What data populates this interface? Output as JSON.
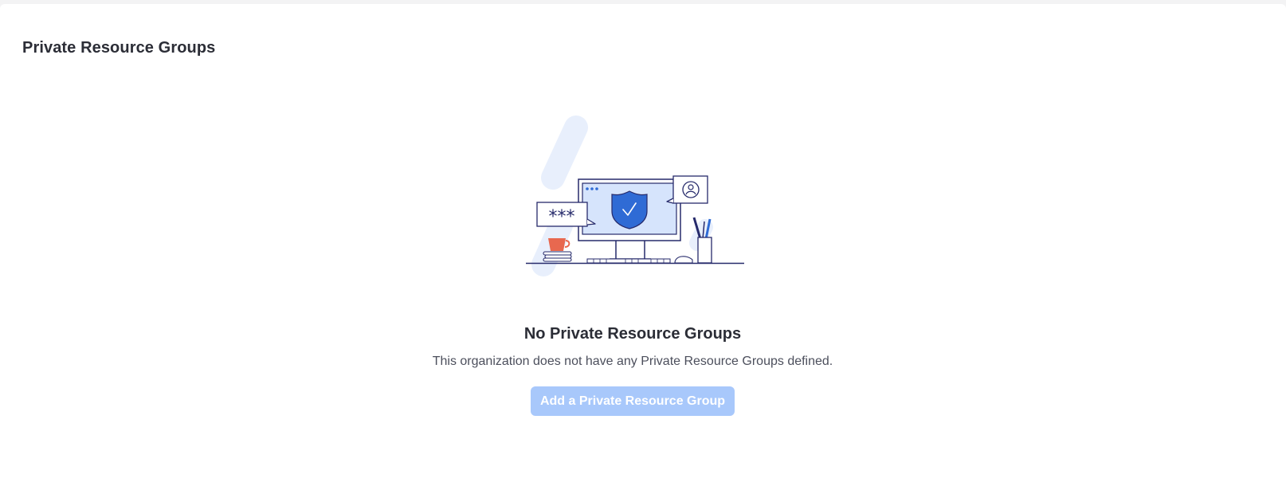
{
  "page": {
    "title": "Private Resource Groups"
  },
  "empty_state": {
    "illustration_icon": "secure-computer-illustration-icon",
    "password_mask": "***",
    "title": "No Private Resource Groups",
    "description": "This organization does not have any Private Resource Groups defined.",
    "add_button_label": "Add a Private Resource Group",
    "add_button_disabled": true
  },
  "colors": {
    "button_disabled_bg": "#a8c8fb",
    "accent_blue": "#2f6bd5",
    "screen_blue": "#d6e4fc",
    "cup_coral": "#e8684f",
    "line_navy": "#262a6b",
    "title_text": "#2b2d36"
  }
}
